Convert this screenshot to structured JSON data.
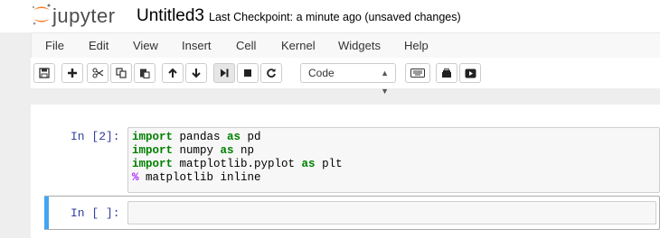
{
  "header": {
    "logo_text": "jupyter",
    "notebook_name": "Untitled3",
    "checkpoint_status": "Last Checkpoint: a minute ago (unsaved changes)"
  },
  "menu": [
    "File",
    "Edit",
    "View",
    "Insert",
    "Cell",
    "Kernel",
    "Widgets",
    "Help"
  ],
  "toolbar": {
    "buttons": [
      "save-icon",
      "plus-icon",
      "scissors-icon",
      "copy-icon",
      "paste-icon",
      "arrow-up-icon",
      "arrow-down-icon",
      "run-icon",
      "stop-icon",
      "restart-icon",
      "keyboard-icon",
      "celltoolbar-icon",
      "presentation-icon"
    ],
    "cell_type": "Code"
  },
  "cells": [
    {
      "prompt": "In [2]:",
      "lines": [
        [
          {
            "t": "import",
            "c": "kw"
          },
          {
            "t": " pandas ",
            "c": ""
          },
          {
            "t": "as",
            "c": "kw"
          },
          {
            "t": " pd",
            "c": ""
          }
        ],
        [
          {
            "t": "import",
            "c": "kw"
          },
          {
            "t": " numpy ",
            "c": ""
          },
          {
            "t": "as",
            "c": "kw"
          },
          {
            "t": " np",
            "c": ""
          }
        ],
        [
          {
            "t": "import",
            "c": "kw"
          },
          {
            "t": " matplotlib.pyplot ",
            "c": ""
          },
          {
            "t": "as",
            "c": "kw"
          },
          {
            "t": " plt",
            "c": ""
          }
        ],
        [
          {
            "t": "%",
            "c": "op"
          },
          {
            "t": " matplotlib inline",
            "c": ""
          }
        ]
      ]
    },
    {
      "prompt": "In [ ]:",
      "lines": []
    }
  ],
  "colors": {
    "keyword": "#008000",
    "prompt": "#303f9f",
    "selected_cell_bar": "#42a5f5",
    "logo_orange": "#f37726"
  }
}
